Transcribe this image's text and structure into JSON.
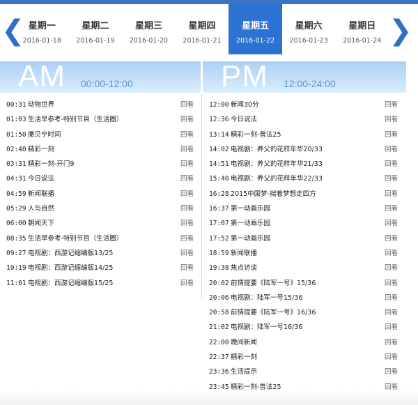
{
  "nav": {
    "prev_arrow": "❮",
    "next_arrow": "❯",
    "days": [
      {
        "name": "星期一",
        "date": "2016-01-18",
        "active": false
      },
      {
        "name": "星期二",
        "date": "2016-01-19",
        "active": false
      },
      {
        "name": "星期三",
        "date": "2016-01-20",
        "active": false
      },
      {
        "name": "星期四",
        "date": "2016-01-21",
        "active": false
      },
      {
        "name": "星期五",
        "date": "2016-01-22",
        "active": true
      },
      {
        "name": "星期六",
        "date": "2016-01-23",
        "active": false
      },
      {
        "name": "星期日",
        "date": "2016-01-24",
        "active": false
      }
    ]
  },
  "am": {
    "label": "AM",
    "range": "00:00-12:00",
    "programs": [
      {
        "time": "00:31",
        "title": "动物世界",
        "action": "回看"
      },
      {
        "time": "01:03",
        "title": "生活早参考-特别节目（生活圈）",
        "action": "回看"
      },
      {
        "time": "01:50",
        "title": "撒贝宁时间",
        "action": "回看"
      },
      {
        "time": "02:40",
        "title": "精彩一刻",
        "action": "回看"
      },
      {
        "time": "03:31",
        "title": "精彩一刻-开门9",
        "action": "回看"
      },
      {
        "time": "04:31",
        "title": "今日说法",
        "action": "回看"
      },
      {
        "time": "04:59",
        "title": "新闻联播",
        "action": "回看"
      },
      {
        "time": "05:29",
        "title": "人与自然",
        "action": "回看"
      },
      {
        "time": "06:00",
        "title": "朝闻天下",
        "action": "回看"
      },
      {
        "time": "08:35",
        "title": "生活早参考-特别节目（生活圈）",
        "action": "回看"
      },
      {
        "time": "09:27",
        "title": "电视剧：西游记缩编版13/25",
        "action": "回看"
      },
      {
        "time": "10:19",
        "title": "电视剧：西游记缩编版14/25",
        "action": "回看"
      },
      {
        "time": "11:01",
        "title": "电视剧：西游记缩编版15/25",
        "action": "回看"
      }
    ]
  },
  "pm": {
    "label": "PM",
    "range": "12:00-24:00",
    "programs": [
      {
        "time": "12:00",
        "title": "新闻30分",
        "action": "回看"
      },
      {
        "time": "12:36",
        "title": "今日说法",
        "action": "回看"
      },
      {
        "time": "13:14",
        "title": "精彩一刻-普法25",
        "action": "回看"
      },
      {
        "time": "14:02",
        "title": "电视剧：养父的花样年华20/33",
        "action": "回看"
      },
      {
        "time": "14:51",
        "title": "电视剧：养父的花样年华21/33",
        "action": "回看"
      },
      {
        "time": "15:40",
        "title": "电视剧：养父的花样年华22/33",
        "action": "回看"
      },
      {
        "time": "16:28",
        "title": "2015中国梦-揣着梦想走四方",
        "action": "回看"
      },
      {
        "time": "16:37",
        "title": "第一动画乐园",
        "action": "回看"
      },
      {
        "time": "17:07",
        "title": "第一动画乐园",
        "action": "回看"
      },
      {
        "time": "17:52",
        "title": "第一动画乐园",
        "action": "回看"
      },
      {
        "time": "18:59",
        "title": "新闻联播",
        "action": "回看"
      },
      {
        "time": "19:38",
        "title": "焦点访谈",
        "action": "回看"
      },
      {
        "time": "20:02",
        "title": "前情提要《陆军一号》15/36",
        "action": "回看"
      },
      {
        "time": "20:06",
        "title": "电视剧：陆军一号15/36",
        "action": "回看"
      },
      {
        "time": "20:58",
        "title": "前情提要《陆军一号》16/36",
        "action": "回看"
      },
      {
        "time": "21:02",
        "title": "电视剧：陆军一号16/36",
        "action": "回看"
      },
      {
        "time": "22:00",
        "title": "晚间新闻",
        "action": "回看"
      },
      {
        "time": "22:37",
        "title": "精彩一刻",
        "action": "回看"
      },
      {
        "time": "23:36",
        "title": "生活提示",
        "action": "回看"
      },
      {
        "time": "23:45",
        "title": "精彩一刻-普法25",
        "action": "回看"
      }
    ]
  }
}
